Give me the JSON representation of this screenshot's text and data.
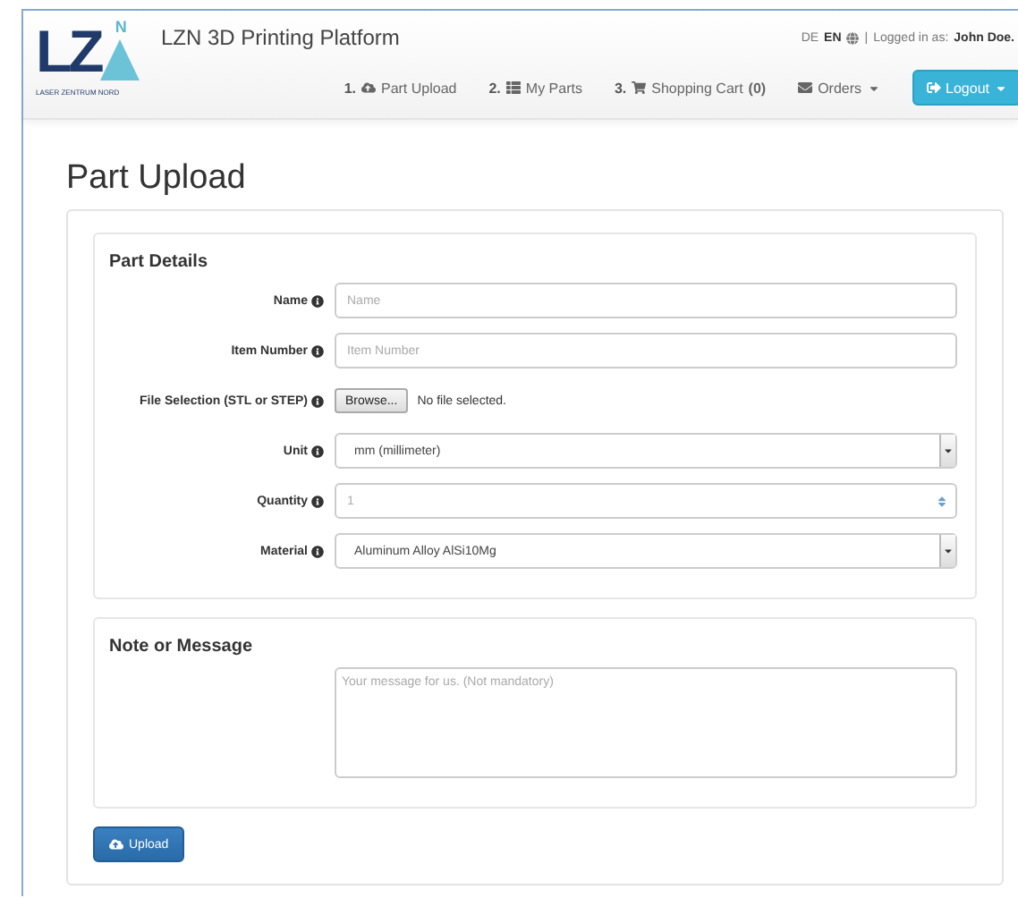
{
  "header": {
    "logo": {
      "letters": "LZ",
      "superscript": "N",
      "tagline": "LASER ZENTRUM NORD"
    },
    "title": "LZN 3D Printing Platform",
    "languages": [
      {
        "label": "DE",
        "selected": false
      },
      {
        "label": "EN",
        "selected": true
      }
    ],
    "separator": "|",
    "login_label": "Logged in as:",
    "user": "John Doe.",
    "nav": [
      {
        "kind": "step",
        "number": "1.",
        "label": "Part Upload"
      },
      {
        "kind": "step",
        "number": "2.",
        "label": "My Parts"
      },
      {
        "kind": "step",
        "number": "3.",
        "label": "Shopping Cart",
        "count": "(0)"
      },
      {
        "kind": "dropdown",
        "label": "Orders"
      },
      {
        "kind": "button",
        "label": "Logout"
      }
    ]
  },
  "page_title": "Part Upload",
  "details": {
    "heading": "Part Details",
    "fields": [
      {
        "kind": "text",
        "label": "Name",
        "placeholder": "Name"
      },
      {
        "kind": "text",
        "label": "Item Number",
        "placeholder": "Item Number"
      },
      {
        "kind": "file",
        "label": "File Selection (STL or STEP)",
        "button": "Browse...",
        "status": "No file selected."
      },
      {
        "kind": "select",
        "label": "Unit",
        "value": "mm (millimeter)"
      },
      {
        "kind": "number",
        "label": "Quantity",
        "placeholder": "1"
      },
      {
        "kind": "select",
        "label": "Material",
        "value": "Aluminum Alloy AlSi10Mg"
      }
    ]
  },
  "note": {
    "heading": "Note or Message",
    "placeholder": "Your message for us. (Not mandatory)"
  },
  "submit": "Upload"
}
